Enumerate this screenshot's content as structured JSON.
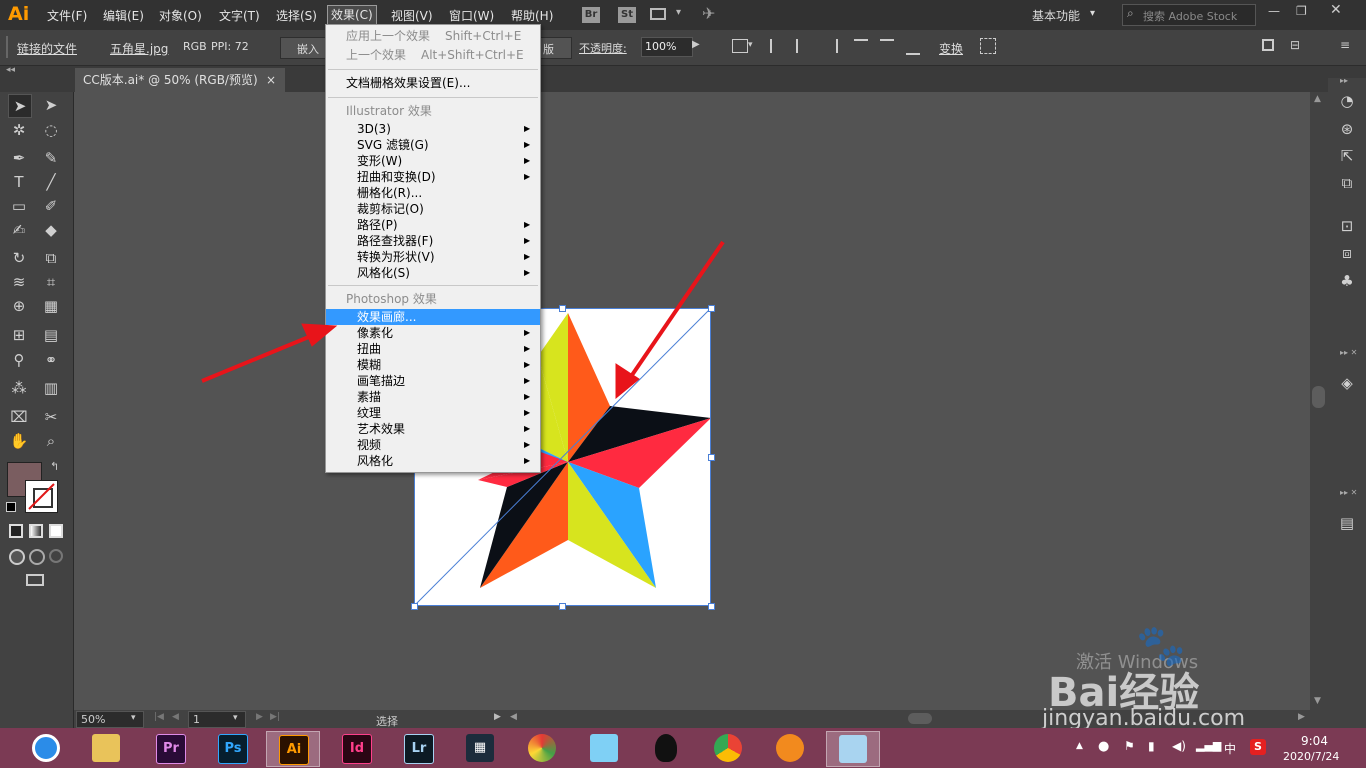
{
  "app": {
    "logo": "Ai"
  },
  "menubar": {
    "items": [
      "文件(F)",
      "编辑(E)",
      "对象(O)",
      "文字(T)",
      "选择(S)",
      "效果(C)",
      "视图(V)",
      "窗口(W)",
      "帮助(H)"
    ],
    "br": "Br",
    "st": "St",
    "workspace": "基本功能",
    "search_placeholder": "搜索 Adobe Stock"
  },
  "control_bar": {
    "linked_file": "链接的文件",
    "file_name": "五角星.jpg",
    "color_mode": "RGB",
    "ppi": "PPI: 72",
    "embed": "嵌入",
    "edit_fragment": "版",
    "opacity_label": "不透明度:",
    "opacity_value": "100%",
    "transform": "变换"
  },
  "document_tab": {
    "title": "CC版本.ai* @ 50% (RGB/预览)",
    "close": "×"
  },
  "effect_menu": {
    "apply_last": "应用上一个效果",
    "apply_last_shortcut": "Shift+Ctrl+E",
    "last_effect": "上一个效果",
    "last_effect_shortcut": "Alt+Shift+Ctrl+E",
    "raster_settings": "文档栅格效果设置(E)...",
    "illustrator_header": "Illustrator 效果",
    "illustrator_items": [
      "3D(3)",
      "SVG 滤镜(G)",
      "变形(W)",
      "扭曲和变换(D)",
      "栅格化(R)...",
      "裁剪标记(O)",
      "路径(P)",
      "路径查找器(F)",
      "转换为形状(V)",
      "风格化(S)"
    ],
    "photoshop_header": "Photoshop 效果",
    "photoshop_items": [
      "效果画廊...",
      "像素化",
      "扭曲",
      "模糊",
      "画笔描边",
      "素描",
      "纹理",
      "艺术效果",
      "视频",
      "风格化"
    ]
  },
  "status_bar": {
    "zoom": "50%",
    "page": "1",
    "mode": "选择"
  },
  "watermark": {
    "activate": "激活 Windows",
    "brand": "Bai经验",
    "url": "jingyan.baidu.com"
  },
  "taskbar": {
    "apps": [
      "Pr",
      "Ps",
      "Ai",
      "Id",
      "Lr"
    ],
    "time": "9:04",
    "date": "2020/7/24",
    "ime": "中"
  },
  "colors": {
    "star_orange": "#ff5a1a",
    "star_yellow": "#d7e41e",
    "star_black": "#0b0f16",
    "star_red": "#ff2a40",
    "star_blue": "#2aa3ff",
    "highlight": "#3399ff",
    "arrow_red": "#e8141a"
  }
}
